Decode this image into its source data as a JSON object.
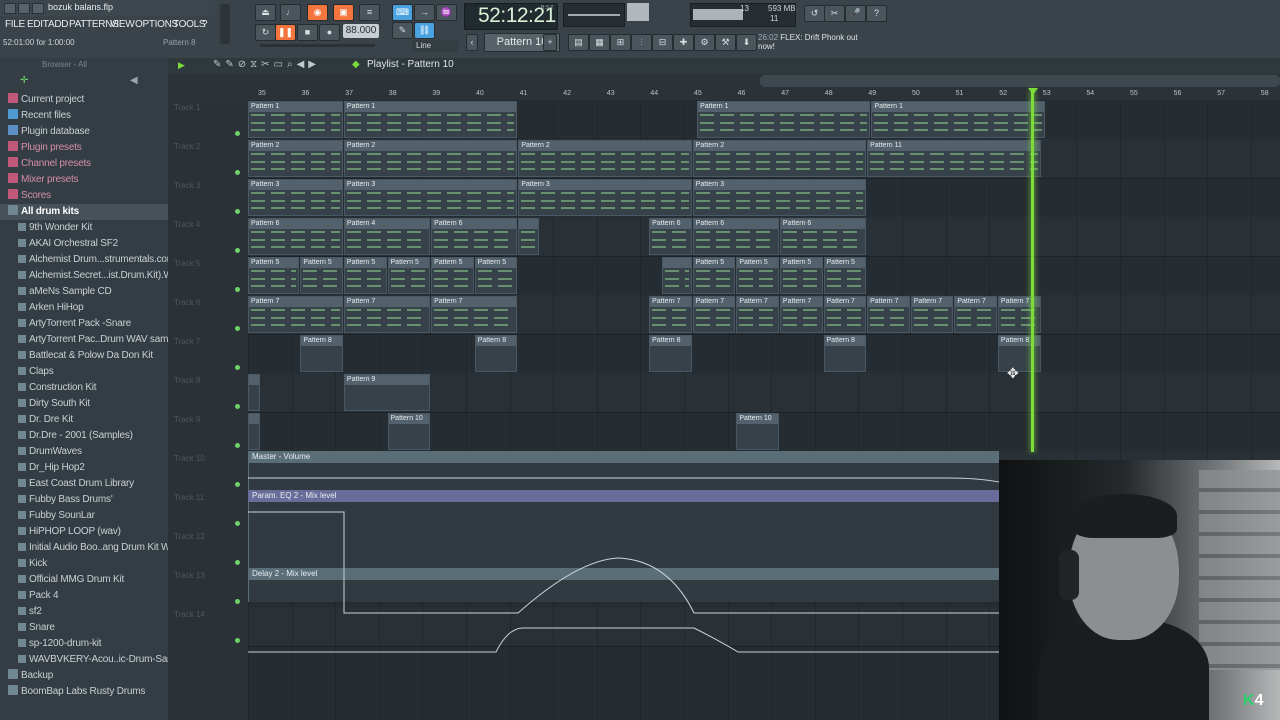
{
  "app": {
    "file_title": "bozuk balans.flp",
    "menu": [
      "FILE",
      "EDIT",
      "ADD",
      "PATTERNS",
      "VIEW",
      "OPTIONS",
      "TOOLS",
      "?"
    ],
    "hint_left": "52:01:00 for 1:00:00",
    "hint_right": "Pattern 8"
  },
  "transport": {
    "time": "52:12:21",
    "time_unit": "B:S:T",
    "tempo": "88.000",
    "pattern": "Pattern 10",
    "snap": "Line",
    "cpu": "13",
    "memory": "593 MB",
    "polyphony": "11",
    "news_time": "26:02",
    "news_text": "FLEX: Drift Phonk out now!"
  },
  "browser": {
    "header": "Browser - All",
    "items": [
      {
        "label": "Current project",
        "type": "cat",
        "icon": "project-icon"
      },
      {
        "label": "Recent files",
        "type": "cat",
        "icon": "recent-files-icon"
      },
      {
        "label": "Plugin database",
        "type": "cat",
        "icon": "plugin-database-icon"
      },
      {
        "label": "Plugin presets",
        "type": "pink",
        "icon": "plugin-presets-icon"
      },
      {
        "label": "Channel presets",
        "type": "pink",
        "icon": "channel-presets-icon"
      },
      {
        "label": "Mixer presets",
        "type": "pink",
        "icon": "mixer-presets-icon"
      },
      {
        "label": "Scores",
        "type": "pink",
        "icon": "scores-icon"
      },
      {
        "label": "All drum kits",
        "type": "sel",
        "icon": "folder-icon"
      },
      {
        "label": "9th Wonder Kit",
        "type": "sub",
        "icon": "folder-icon"
      },
      {
        "label": "AKAI Orchestral SF2",
        "type": "sub",
        "icon": "folder-icon"
      },
      {
        "label": "Alchemist Drum...strumentals.com)",
        "type": "sub",
        "icon": "folder-icon"
      },
      {
        "label": "Alchemist.Secret...ist.Drum.Kit).WAV",
        "type": "sub",
        "icon": "folder-icon"
      },
      {
        "label": "aMeNs Sample CD",
        "type": "sub",
        "icon": "folder-icon"
      },
      {
        "label": "Arken HiHop",
        "type": "sub",
        "icon": "folder-icon"
      },
      {
        "label": "ArtyTorrent Pack -Snare",
        "type": "sub",
        "icon": "folder-icon"
      },
      {
        "label": "ArtyTorrent Pac..Drum WAV samples",
        "type": "sub",
        "icon": "folder-icon"
      },
      {
        "label": "Battlecat & Polow Da Don Kit",
        "type": "sub",
        "icon": "folder-icon"
      },
      {
        "label": "Claps",
        "type": "sub",
        "icon": "folder-icon"
      },
      {
        "label": "Construction Kit",
        "type": "sub",
        "icon": "folder-icon"
      },
      {
        "label": "Dirty South Kit",
        "type": "sub",
        "icon": "folder-icon"
      },
      {
        "label": "Dr. Dre Kit",
        "type": "sub",
        "icon": "folder-icon"
      },
      {
        "label": "Dr.Dre - 2001 (Samples)",
        "type": "sub",
        "icon": "folder-icon"
      },
      {
        "label": "DrumWaves",
        "type": "sub",
        "icon": "folder-icon"
      },
      {
        "label": "Dr_Hip Hop2",
        "type": "sub",
        "icon": "folder-icon"
      },
      {
        "label": "East Coast Drum Library",
        "type": "sub",
        "icon": "folder-icon"
      },
      {
        "label": "Fubby  Bass Drums'",
        "type": "sub",
        "icon": "folder-icon"
      },
      {
        "label": "Fubby SounLar",
        "type": "sub",
        "icon": "folder-icon"
      },
      {
        "label": "HiPHOP LOOP (wav)",
        "type": "sub",
        "icon": "folder-icon"
      },
      {
        "label": "Initial Audio Boo..ang Drum Kit WiN",
        "type": "sub",
        "icon": "folder-icon"
      },
      {
        "label": "Kick",
        "type": "sub",
        "icon": "folder-icon"
      },
      {
        "label": "Official MMG Drum Kit",
        "type": "sub",
        "icon": "folder-icon"
      },
      {
        "label": "Pack 4",
        "type": "sub",
        "icon": "folder-icon"
      },
      {
        "label": "sf2",
        "type": "sub",
        "icon": "folder-icon"
      },
      {
        "label": "Snare",
        "type": "sub",
        "icon": "folder-icon"
      },
      {
        "label": "sp-1200-drum-kit",
        "type": "sub",
        "icon": "folder-icon"
      },
      {
        "label": "WAVBVKERY-Acou..ic-Drum-Samples",
        "type": "sub",
        "icon": "folder-icon"
      },
      {
        "label": "Backup",
        "type": "cat",
        "icon": "folder-icon"
      },
      {
        "label": "BoomBap Labs Rusty Drums",
        "type": "cat",
        "icon": "folder-icon"
      }
    ]
  },
  "playlist": {
    "title": "Playlist - Pattern 10",
    "ruler": [
      "35",
      "36",
      "37",
      "38",
      "39",
      "40",
      "41",
      "42",
      "43",
      "44",
      "45",
      "46",
      "47",
      "48",
      "49",
      "50",
      "51",
      "52",
      "53",
      "54",
      "55",
      "56",
      "57",
      "58"
    ],
    "tracks": [
      "Track 1",
      "Track 2",
      "Track 3",
      "Track 4",
      "Track 5",
      "Track 6",
      "Track 7",
      "Track 8",
      "Track 9",
      "Track 10",
      "Track 11",
      "Track 12",
      "Track 13",
      "Track 14"
    ],
    "clips": [
      {
        "t": 0,
        "s": 0,
        "w": 2.2,
        "label": "Pattern 1"
      },
      {
        "t": 0,
        "s": 2.2,
        "w": 4,
        "label": "Pattern 1"
      },
      {
        "t": 0,
        "s": 10.3,
        "w": 4,
        "label": "Pattern 1"
      },
      {
        "t": 0,
        "s": 14.3,
        "w": 4,
        "label": "Pattern 1"
      },
      {
        "t": 1,
        "s": 0,
        "w": 2.2,
        "label": "Pattern 2"
      },
      {
        "t": 1,
        "s": 2.2,
        "w": 4,
        "label": "Pattern 2"
      },
      {
        "t": 1,
        "s": 6.2,
        "w": 4,
        "label": "Pattern 2"
      },
      {
        "t": 1,
        "s": 10.2,
        "w": 4,
        "label": "Pattern 2"
      },
      {
        "t": 1,
        "s": 14.2,
        "w": 4,
        "label": "Pattern 11"
      },
      {
        "t": 2,
        "s": 0,
        "w": 2.2,
        "label": "Pattern 3"
      },
      {
        "t": 2,
        "s": 2.2,
        "w": 4,
        "label": "Pattern 3"
      },
      {
        "t": 2,
        "s": 6.2,
        "w": 4,
        "label": "Pattern 3"
      },
      {
        "t": 2,
        "s": 10.2,
        "w": 4,
        "label": "Pattern 3"
      },
      {
        "t": 3,
        "s": 0,
        "w": 2.2,
        "label": "Pattern 6"
      },
      {
        "t": 3,
        "s": 2.2,
        "w": 2,
        "label": "Pattern 4"
      },
      {
        "t": 3,
        "s": 4.2,
        "w": 2,
        "label": "Pattern 6"
      },
      {
        "t": 3,
        "s": 6.2,
        "w": 0.5,
        "label": ""
      },
      {
        "t": 3,
        "s": 9.2,
        "w": 1,
        "label": "Pattern 6"
      },
      {
        "t": 3,
        "s": 10.2,
        "w": 2,
        "label": "Pattern 6"
      },
      {
        "t": 3,
        "s": 12.2,
        "w": 2,
        "label": "Pattern 6"
      },
      {
        "t": 4,
        "s": 0,
        "w": 1.2,
        "label": "Pattern 5"
      },
      {
        "t": 4,
        "s": 1.2,
        "w": 1,
        "label": "Pattern 5"
      },
      {
        "t": 4,
        "s": 2.2,
        "w": 1,
        "label": "Pattern 5"
      },
      {
        "t": 4,
        "s": 3.2,
        "w": 1,
        "label": "Pattern 5"
      },
      {
        "t": 4,
        "s": 4.2,
        "w": 1,
        "label": "Pattern 5"
      },
      {
        "t": 4,
        "s": 5.2,
        "w": 1,
        "label": "Pattern 5"
      },
      {
        "t": 4,
        "s": 9.5,
        "w": 0.7,
        "label": ""
      },
      {
        "t": 4,
        "s": 10.2,
        "w": 1,
        "label": "Pattern 5"
      },
      {
        "t": 4,
        "s": 11.2,
        "w": 1,
        "label": "Pattern 5"
      },
      {
        "t": 4,
        "s": 12.2,
        "w": 1,
        "label": "Pattern 5"
      },
      {
        "t": 4,
        "s": 13.2,
        "w": 1,
        "label": "Pattern 5"
      },
      {
        "t": 5,
        "s": 0,
        "w": 2.2,
        "label": "Pattern 7"
      },
      {
        "t": 5,
        "s": 2.2,
        "w": 2,
        "label": "Pattern 7"
      },
      {
        "t": 5,
        "s": 4.2,
        "w": 2,
        "label": "Pattern 7"
      },
      {
        "t": 5,
        "s": 9.2,
        "w": 1,
        "label": "Pattern 7"
      },
      {
        "t": 5,
        "s": 10.2,
        "w": 1,
        "label": "Pattern 7"
      },
      {
        "t": 5,
        "s": 11.2,
        "w": 1,
        "label": "Pattern 7"
      },
      {
        "t": 5,
        "s": 12.2,
        "w": 1,
        "label": "Pattern 7"
      },
      {
        "t": 5,
        "s": 13.2,
        "w": 1,
        "label": "Pattern 7"
      },
      {
        "t": 5,
        "s": 14.2,
        "w": 1,
        "label": "Pattern 7"
      },
      {
        "t": 5,
        "s": 15.2,
        "w": 1,
        "label": "Pattern 7"
      },
      {
        "t": 5,
        "s": 16.2,
        "w": 1,
        "label": "Pattern 7"
      },
      {
        "t": 5,
        "s": 17.2,
        "w": 1,
        "label": "Pattern 7"
      },
      {
        "t": 6,
        "s": 1.2,
        "w": 1,
        "label": "Pattern 8"
      },
      {
        "t": 6,
        "s": 5.2,
        "w": 1,
        "label": "Pattern 8"
      },
      {
        "t": 6,
        "s": 9.2,
        "w": 1,
        "label": "Pattern 8"
      },
      {
        "t": 6,
        "s": 13.2,
        "w": 1,
        "label": "Pattern 8"
      },
      {
        "t": 6,
        "s": 17.2,
        "w": 1,
        "label": "Pattern 8"
      },
      {
        "t": 7,
        "s": 0,
        "w": 0.3,
        "label": ""
      },
      {
        "t": 7,
        "s": 2.2,
        "w": 2,
        "label": "Pattern 9"
      },
      {
        "t": 8,
        "s": 0,
        "w": 0.3,
        "label": ""
      },
      {
        "t": 8,
        "s": 3.2,
        "w": 1,
        "label": "Pattern 10"
      },
      {
        "t": 8,
        "s": 11.2,
        "w": 1,
        "label": "Pattern 10"
      }
    ],
    "automation": [
      {
        "t": 9,
        "label": "Master - Volume"
      },
      {
        "t": 10,
        "label": "Param. EQ 2 - Mix level"
      },
      {
        "t": 12,
        "label": "Delay 2 - Mix level"
      }
    ]
  },
  "webcam": {
    "logo_k": "K",
    "logo_num": "4"
  }
}
